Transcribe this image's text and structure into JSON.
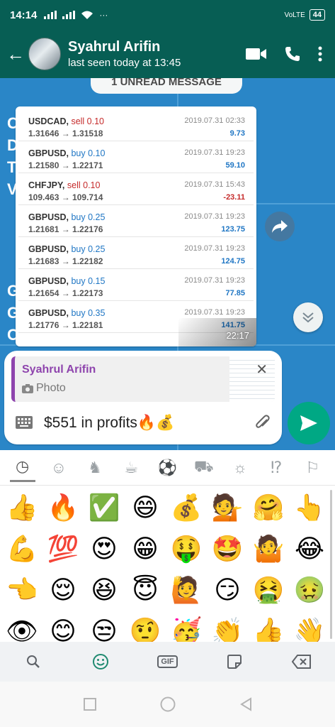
{
  "statusbar": {
    "time": "14:14",
    "network": "VoLTE",
    "battery": "44"
  },
  "header": {
    "contact_name": "Syahrul Arifin",
    "last_seen": "last seen today at 13:45"
  },
  "chat": {
    "unread_banner": "1 UNREAD MESSAGE",
    "wallpaper_letters": [
      "C",
      "D",
      "T",
      "V",
      "G",
      "G",
      "O"
    ],
    "image_message": {
      "time": "22:17",
      "trades": [
        {
          "symbol": "USDCAD,",
          "side": "sell 0.10",
          "side_type": "sell",
          "prices": "1.31646 → 1.31518",
          "date": "2019.07.31 02:33",
          "pl": "9.73",
          "pl_type": "pos"
        },
        {
          "symbol": "GBPUSD,",
          "side": "buy 0.10",
          "side_type": "buy",
          "prices": "1.21580 → 1.22171",
          "date": "2019.07.31 19:23",
          "pl": "59.10",
          "pl_type": "pos"
        },
        {
          "symbol": "CHFJPY,",
          "side": "sell 0.10",
          "side_type": "sell",
          "prices": "109.463 → 109.714",
          "date": "2019.07.31 15:43",
          "pl": "-23.11",
          "pl_type": "neg"
        },
        {
          "symbol": "GBPUSD,",
          "side": "buy 0.25",
          "side_type": "buy",
          "prices": "1.21681 → 1.22176",
          "date": "2019.07.31 19:23",
          "pl": "123.75",
          "pl_type": "pos"
        },
        {
          "symbol": "GBPUSD,",
          "side": "buy 0.25",
          "side_type": "buy",
          "prices": "1.21683 → 1.22182",
          "date": "2019.07.31 19:23",
          "pl": "124.75",
          "pl_type": "pos"
        },
        {
          "symbol": "GBPUSD,",
          "side": "buy 0.15",
          "side_type": "buy",
          "prices": "1.21654 → 1.22173",
          "date": "2019.07.31 19:23",
          "pl": "77.85",
          "pl_type": "pos"
        },
        {
          "symbol": "GBPUSD,",
          "side": "buy 0.35",
          "side_type": "buy",
          "prices": "1.21776 → 1.22181",
          "date": "2019.07.31 19:23",
          "pl": "141.75",
          "pl_type": "pos"
        }
      ]
    }
  },
  "composer": {
    "reply_name": "Syahrul Arifin",
    "reply_type": "Photo",
    "message_text": "$551 in profits🔥💰"
  },
  "emoji_panel": {
    "categories": [
      "recent-icon",
      "smileys-icon",
      "animals-icon",
      "food-icon",
      "activity-icon",
      "travel-icon",
      "objects-icon",
      "symbols-icon",
      "flags-icon"
    ],
    "active_category": "recent-icon",
    "emojis": [
      "👍",
      "🔥",
      "✅",
      "😄",
      "💰",
      "💁",
      "🤗",
      "👆",
      "💪",
      "💯",
      "😍",
      "😁",
      "🤑",
      "🤩",
      "🤷",
      "😂",
      "👈",
      "😌",
      "😆",
      "😇",
      "🙋",
      "😏",
      "🤮",
      "🤢",
      "👁",
      "😊",
      "😒",
      "🤨",
      "🥳",
      "👏",
      "👍",
      "👋"
    ],
    "toolbar": [
      "search-icon",
      "emoji-icon",
      "gif-icon",
      "sticker-icon",
      "backspace-icon"
    ],
    "gif_label": "GIF"
  },
  "colors": {
    "header": "#075e54",
    "chat_bg": "#2a86c7",
    "send": "#00a884",
    "reply_accent": "#8e44ad"
  }
}
